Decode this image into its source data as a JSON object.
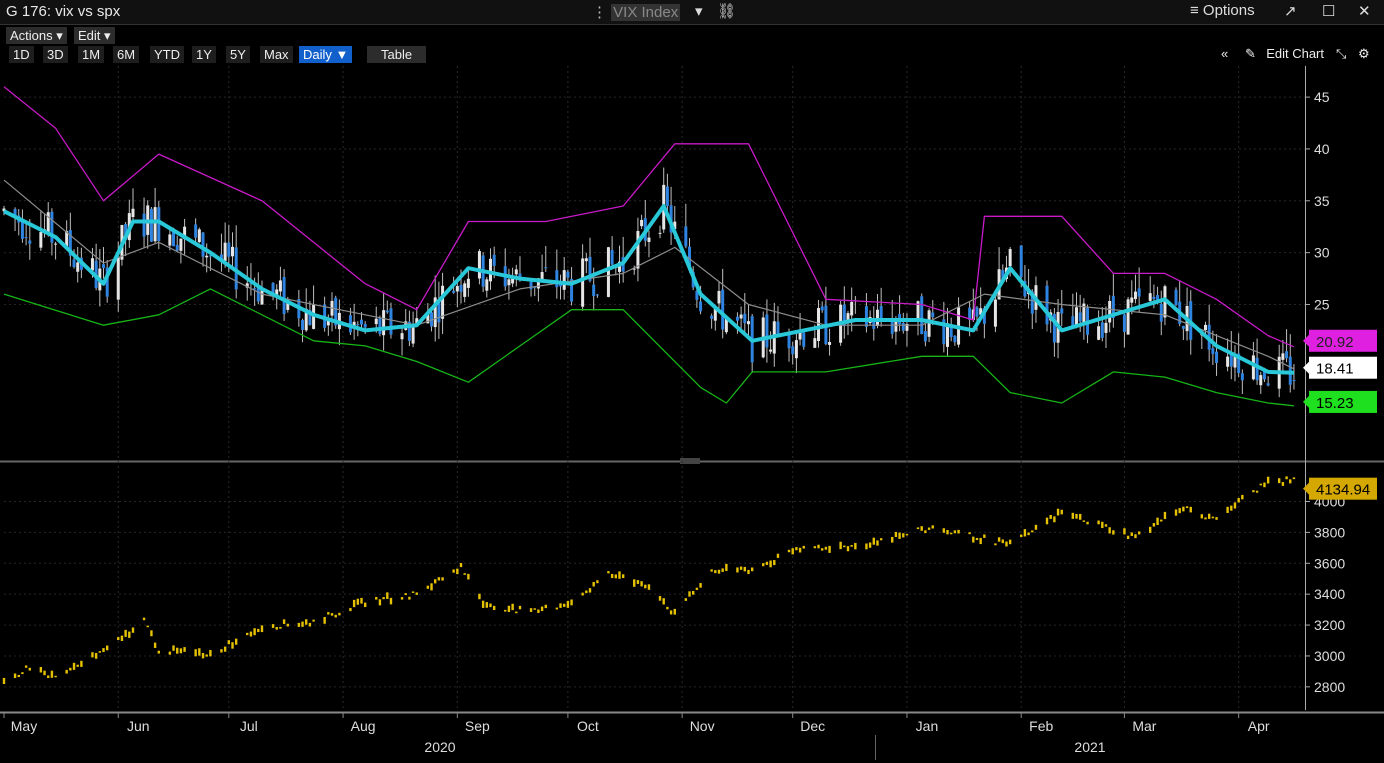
{
  "window": {
    "title": "G 176: vix vs spx",
    "ticker": "VIX Index",
    "options_label": "≡ Options"
  },
  "toolbar": {
    "actions_label": "Actions ▾",
    "edit_label": "Edit ▾",
    "ranges": [
      "1D",
      "3D",
      "1M",
      "6M",
      "YTD",
      "1Y",
      "5Y",
      "Max"
    ],
    "period_label": "Daily ▼",
    "table_label": "Table",
    "edit_chart_label": "Edit Chart"
  },
  "colors": {
    "candle_up": "#e6e6e6",
    "candle_down": "#2e84e0",
    "ma_line": "#28c8d8",
    "upper_band": "#c81ac8",
    "lower_band": "#16b416",
    "mid_band": "#8c8c8c",
    "spx": "#e5c100",
    "badge_upper": "#e020e0",
    "badge_last": "#ffffff",
    "badge_lower": "#1ee01e",
    "badge_spx": "#d4a800"
  },
  "chart_data": [
    {
      "type": "line",
      "series": [
        {
          "name": "",
          "role": "moving_average",
          "x": [
            "2020-05-01",
            "2020-05-15",
            "2020-05-28",
            "2020-06-05",
            "2020-06-12",
            "2020-06-26",
            "2020-07-10",
            "2020-07-24",
            "2020-08-07",
            "2020-08-21",
            "2020-09-04",
            "2020-09-18",
            "2020-10-02",
            "2020-10-16",
            "2020-10-27",
            "2020-11-06",
            "2020-11-20",
            "2020-12-04",
            "2020-12-18",
            "2021-01-05",
            "2021-01-19",
            "2021-01-29",
            "2021-02-12",
            "2021-02-26",
            "2021-03-12",
            "2021-03-26",
            "2021-04-09",
            "2021-04-16"
          ],
          "values": [
            34,
            31.5,
            27,
            33,
            33,
            30,
            26.5,
            24,
            22.5,
            23,
            28.5,
            27.5,
            27,
            29,
            34.5,
            26,
            21.5,
            22.5,
            23.5,
            23.5,
            22.5,
            28.5,
            22.5,
            24,
            25.5,
            21,
            18.5,
            18.41
          ]
        },
        {
          "name": "",
          "role": "upper_band",
          "x": [
            "2020-05-01",
            "2020-05-15",
            "2020-05-28",
            "2020-06-12",
            "2020-07-10",
            "2020-07-24",
            "2020-08-07",
            "2020-08-21",
            "2020-09-04",
            "2020-09-25",
            "2020-10-16",
            "2020-10-30",
            "2020-11-19",
            "2020-12-10",
            "2021-01-05",
            "2021-01-19",
            "2021-01-22",
            "2021-02-12",
            "2021-02-26",
            "2021-03-12",
            "2021-03-26",
            "2021-04-09",
            "2021-04-16"
          ],
          "values": [
            46,
            42,
            35,
            39.5,
            35,
            31,
            27,
            24.5,
            33,
            33,
            34.5,
            40.5,
            40.5,
            25.5,
            25,
            23.5,
            33.5,
            33.5,
            28,
            28,
            25.5,
            22,
            20.92
          ]
        },
        {
          "name": "",
          "role": "middle_band",
          "x": [
            "2020-05-01",
            "2020-05-28",
            "2020-06-12",
            "2020-07-10",
            "2020-08-07",
            "2020-08-21",
            "2020-09-18",
            "2020-10-16",
            "2020-10-30",
            "2020-11-19",
            "2020-12-10",
            "2021-01-05",
            "2021-01-22",
            "2021-02-12",
            "2021-03-12",
            "2021-04-09",
            "2021-04-16"
          ],
          "values": [
            37,
            29,
            31,
            26,
            24,
            23,
            26.5,
            28,
            30.5,
            25,
            23,
            23,
            26,
            25,
            24,
            20,
            18.8
          ]
        },
        {
          "name": "",
          "role": "lower_band",
          "x": [
            "2020-05-01",
            "2020-05-28",
            "2020-06-12",
            "2020-06-26",
            "2020-07-24",
            "2020-08-07",
            "2020-08-21",
            "2020-09-04",
            "2020-09-18",
            "2020-10-02",
            "2020-10-16",
            "2020-11-06",
            "2020-11-13",
            "2020-11-20",
            "2020-12-10",
            "2021-01-05",
            "2021-01-19",
            "2021-01-29",
            "2021-02-12",
            "2021-02-26",
            "2021-03-12",
            "2021-03-26",
            "2021-04-09",
            "2021-04-16"
          ],
          "values": [
            26,
            23,
            24,
            26.5,
            21.5,
            21,
            19.5,
            17.5,
            21,
            24.5,
            24.5,
            17,
            15.5,
            18.5,
            18.5,
            20,
            20,
            16.5,
            15.5,
            18.5,
            18,
            16.5,
            15.5,
            15.23
          ]
        }
      ],
      "ylim": [
        10,
        48
      ],
      "yticks": [
        25,
        30,
        35,
        40,
        45
      ],
      "badges": {
        "upper": "20.92",
        "last": "18.41",
        "lower": "15.23"
      }
    },
    {
      "type": "line",
      "series": [
        {
          "name": "",
          "role": "spx",
          "x": [
            "2020-05-01",
            "2020-05-08",
            "2020-05-15",
            "2020-05-29",
            "2020-06-08",
            "2020-06-12",
            "2020-06-26",
            "2020-07-10",
            "2020-07-24",
            "2020-08-07",
            "2020-08-21",
            "2020-09-02",
            "2020-09-08",
            "2020-09-21",
            "2020-10-02",
            "2020-10-12",
            "2020-10-23",
            "2020-10-30",
            "2020-11-09",
            "2020-11-20",
            "2020-12-04",
            "2020-12-18",
            "2021-01-08",
            "2021-01-29",
            "2021-02-12",
            "2021-03-04",
            "2021-03-17",
            "2021-03-25",
            "2021-04-09",
            "2021-04-16"
          ],
          "values": [
            2830,
            2930,
            2860,
            3040,
            3230,
            3040,
            3010,
            3190,
            3220,
            3350,
            3400,
            3580,
            3340,
            3280,
            3350,
            3530,
            3460,
            3270,
            3550,
            3560,
            3700,
            3710,
            3830,
            3720,
            3930,
            3770,
            3970,
            3880,
            4130,
            4134.94
          ]
        }
      ],
      "ylim": [
        2650,
        4230
      ],
      "yticks": [
        2800,
        3000,
        3200,
        3400,
        3600,
        3800,
        4000
      ],
      "badges": {
        "last": "4134.94"
      }
    }
  ],
  "xaxis": {
    "months": [
      "May",
      "Jun",
      "Jul",
      "Aug",
      "Sep",
      "Oct",
      "Nov",
      "Dec",
      "Jan",
      "Feb",
      "Mar",
      "Apr"
    ],
    "year_2020": "2020",
    "year_2021": "2021"
  }
}
